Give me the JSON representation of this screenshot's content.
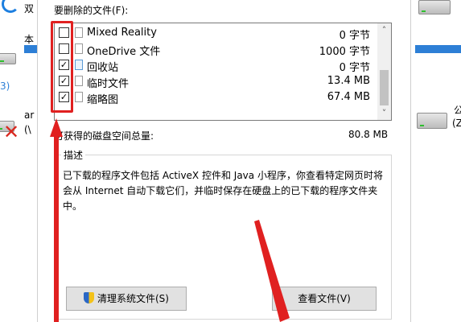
{
  "background": {
    "left_texts": [
      "双",
      "本",
      "3)",
      "ar",
      "(\\"
    ],
    "right_texts": [
      "公",
      "(Z"
    ]
  },
  "dialog": {
    "files_label": "要删除的文件(F):",
    "files": [
      {
        "name": "Mixed Reality",
        "size": "0 字节",
        "checked": false,
        "icon": "file-icon"
      },
      {
        "name": "OneDrive 文件",
        "size": "1000 字节",
        "checked": false,
        "icon": "file-icon"
      },
      {
        "name": "回收站",
        "size": "0 字节",
        "checked": true,
        "icon": "recycle-bin-icon"
      },
      {
        "name": "临时文件",
        "size": "13.4 MB",
        "checked": true,
        "icon": "file-icon"
      },
      {
        "name": "缩略图",
        "size": "67.4 MB",
        "checked": true,
        "icon": "file-icon"
      }
    ],
    "total_label": "可获得的磁盘空间总量:",
    "total_value": "80.8 MB",
    "description_title": "描述",
    "description_text": "已下载的程序文件包括 ActiveX 控件和 Java 小程序，你查看特定网页时将会从 Internet 自动下载它们，并临时保存在硬盘上的已下载的程序文件夹中。",
    "clean_system_button": "清理系统文件(S)",
    "view_files_button": "查看文件(V)"
  },
  "annotation_color": "#e02020"
}
